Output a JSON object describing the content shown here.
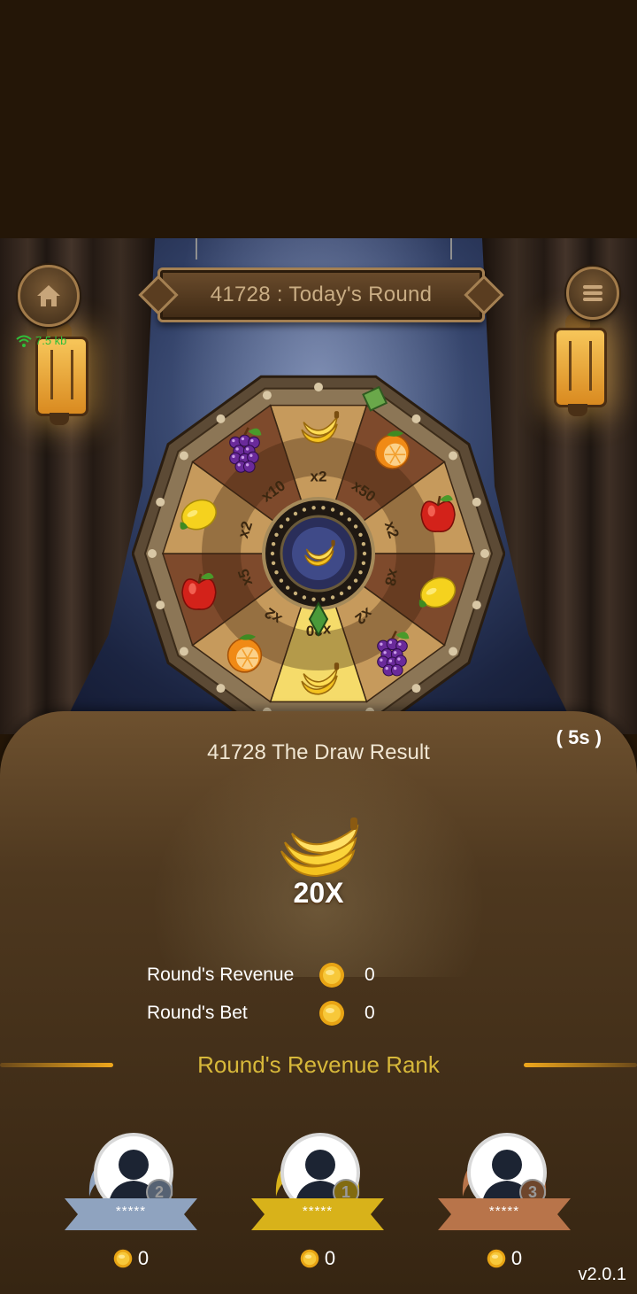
{
  "stage": {
    "round_title": "41728 : Today's Round",
    "network": "7.5 kb",
    "icons": [
      "home-icon",
      "menu-icon",
      "wifi-icon"
    ]
  },
  "wheel": {
    "segments": [
      {
        "fruit": "banana",
        "multiplier": "x2"
      },
      {
        "fruit": "orange",
        "multiplier": "x50"
      },
      {
        "fruit": "apple",
        "multiplier": "x2"
      },
      {
        "fruit": "lemon",
        "multiplier": "x8"
      },
      {
        "fruit": "grape",
        "multiplier": "x2"
      },
      {
        "fruit": "banana",
        "multiplier": "x20"
      },
      {
        "fruit": "orange",
        "multiplier": "x2"
      },
      {
        "fruit": "apple",
        "multiplier": "x5"
      },
      {
        "fruit": "lemon",
        "multiplier": "x2"
      },
      {
        "fruit": "grape",
        "multiplier": "x10"
      }
    ],
    "center_fruit": "banana",
    "highlighted_index": 5
  },
  "result": {
    "title": "41728 The Draw Result",
    "countdown": "( 5s )",
    "fruit": "banana",
    "multiplier": "20X",
    "revenue_label": "Round's Revenue",
    "revenue_value": "0",
    "bet_label": "Round's Bet",
    "bet_value": "0"
  },
  "rank": {
    "title": "Round's Revenue Rank",
    "players": [
      {
        "rank": "2",
        "name": "*****",
        "coins": "0",
        "color": "#8fa3bf"
      },
      {
        "rank": "1",
        "name": "*****",
        "coins": "0",
        "color": "#d8b21a"
      },
      {
        "rank": "3",
        "name": "*****",
        "coins": "0",
        "color": "#b8744a"
      }
    ]
  },
  "version": "v2.0.1",
  "colors": {
    "panel": "#4e381f",
    "rank_title": "#d7b83a",
    "accent_line": "#f0a81c"
  }
}
